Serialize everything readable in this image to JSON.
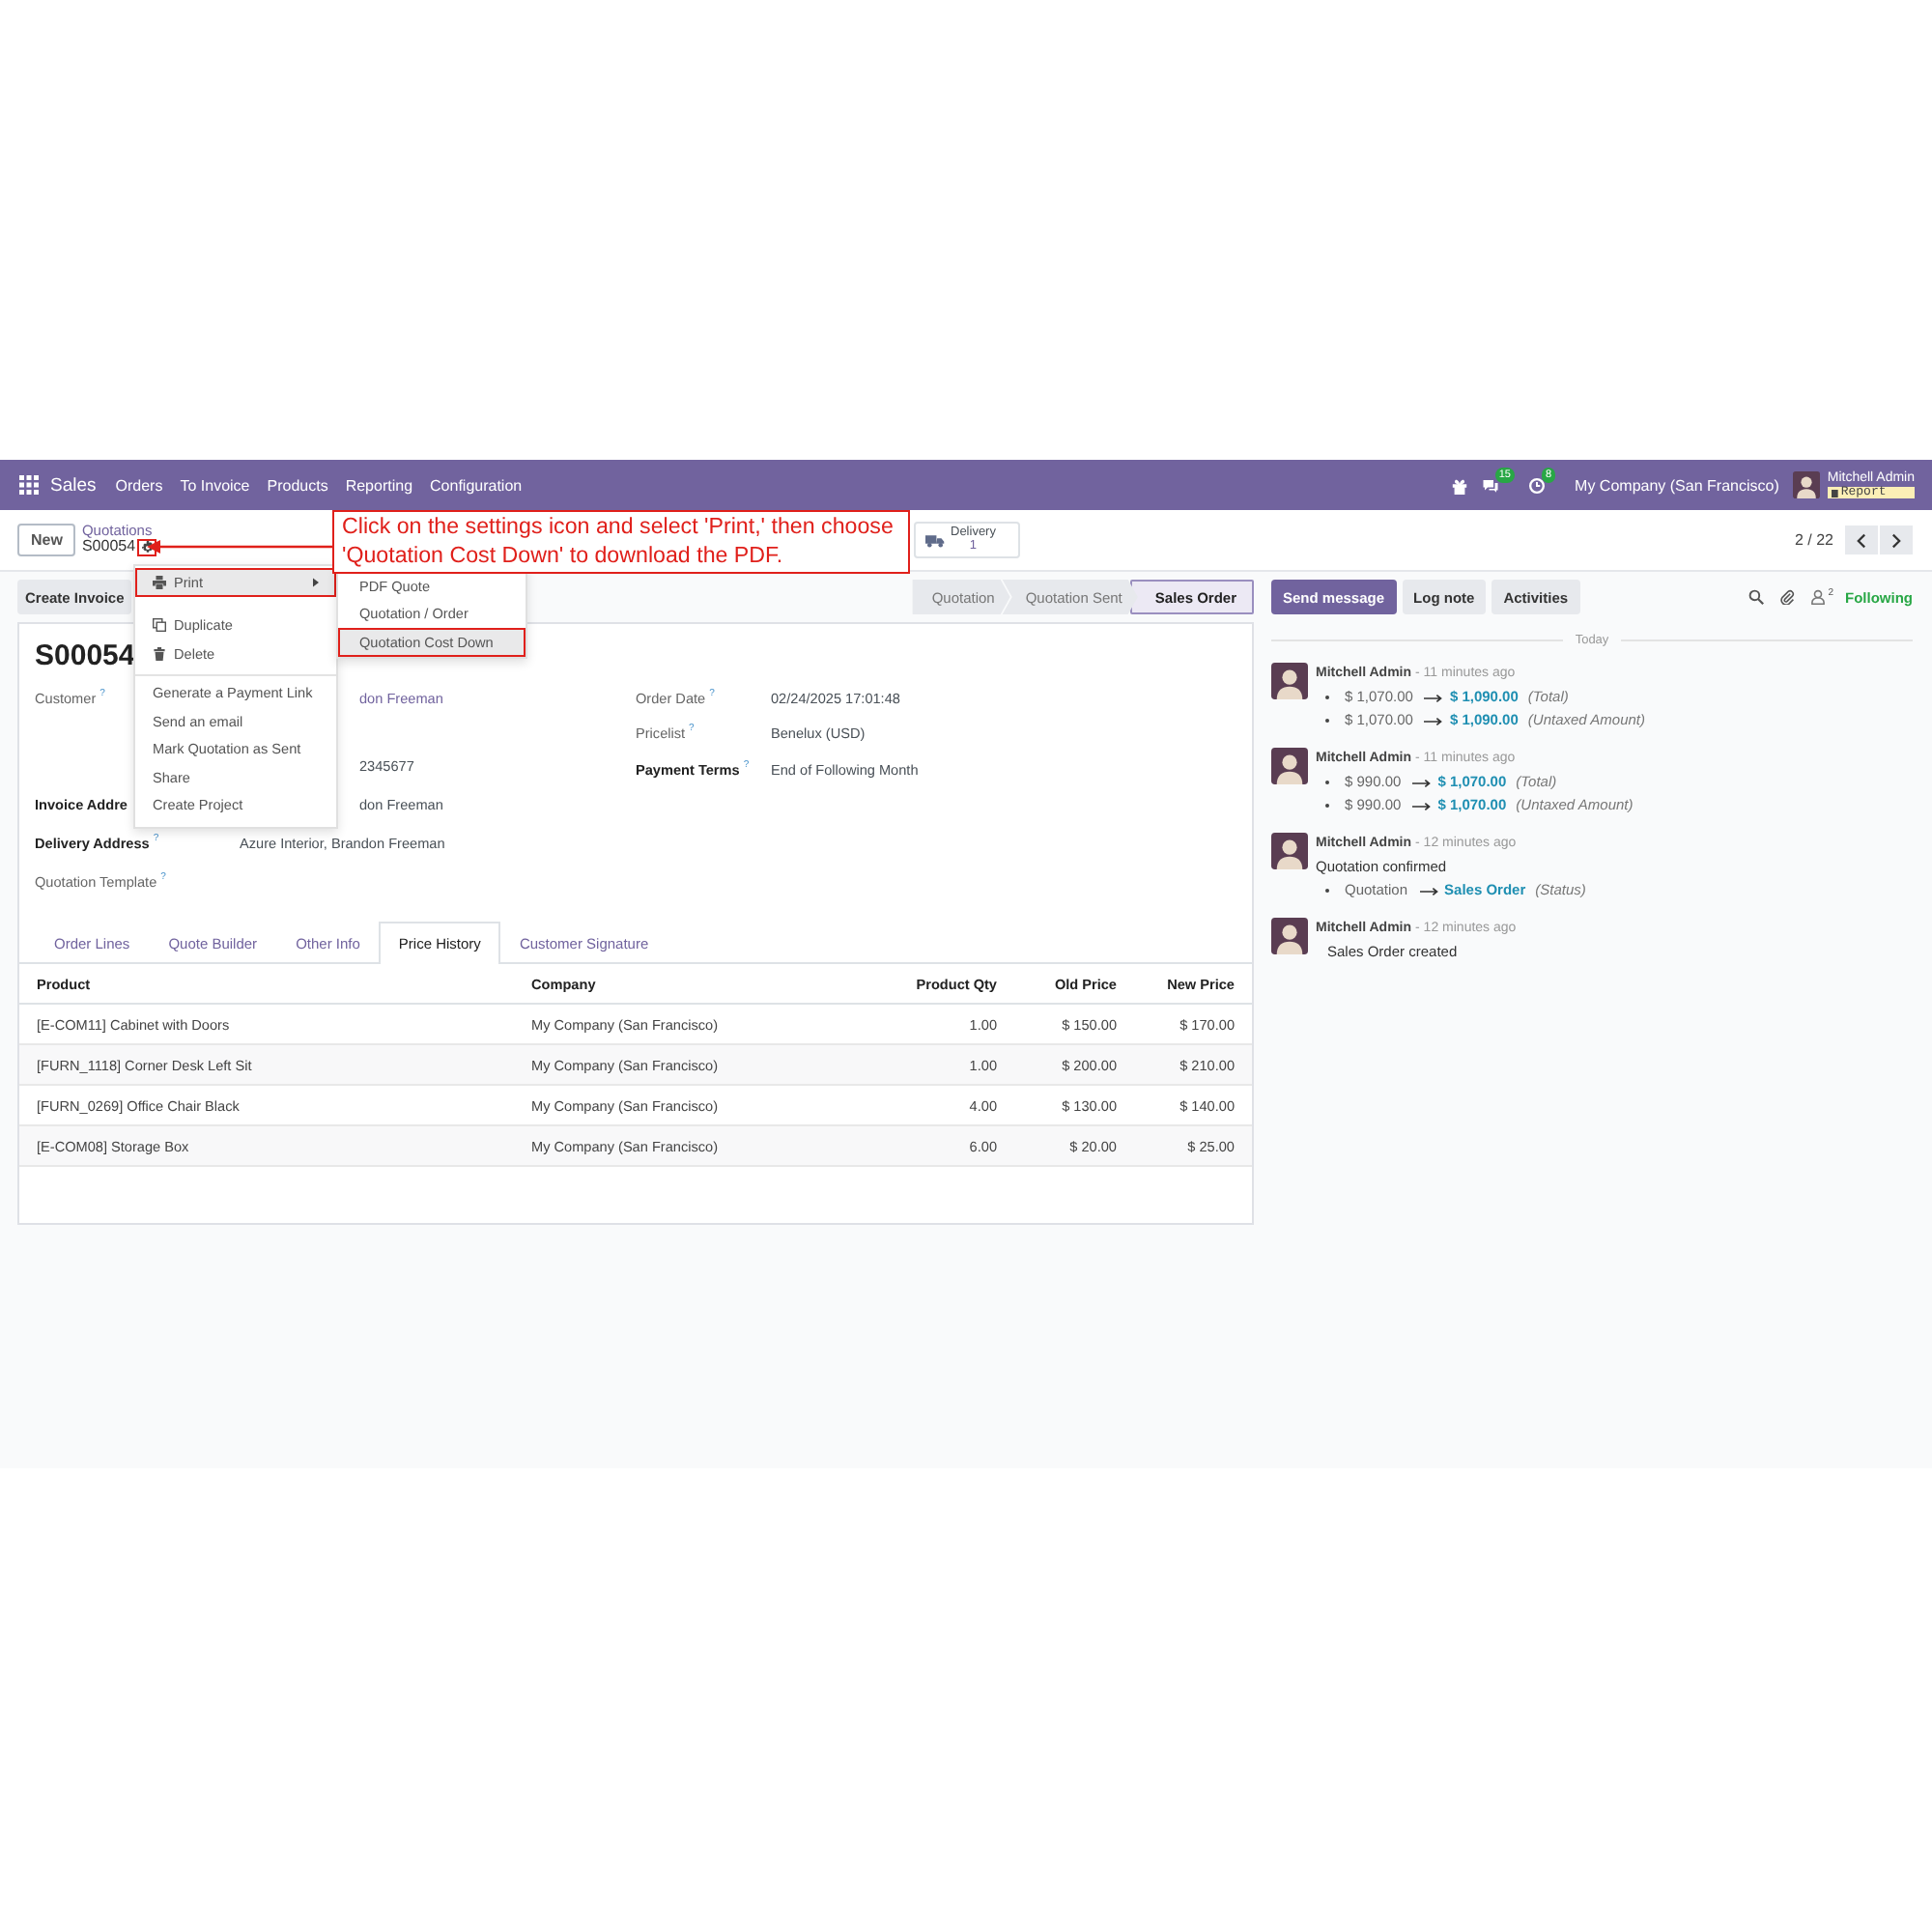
{
  "navbar": {
    "app": "Sales",
    "menu": [
      "Orders",
      "To Invoice",
      "Products",
      "Reporting",
      "Configuration"
    ],
    "messages_count": "15",
    "activities_count": "8",
    "company": "My Company (San Francisco)",
    "user": "Mitchell Admin",
    "database": "Report"
  },
  "control_panel": {
    "new_button": "New",
    "breadcrumb": "Quotations",
    "record": "S00054",
    "gear_highlighted": true,
    "smart_button": {
      "label": "Delivery",
      "count": "1"
    },
    "pager": "2 / 22"
  },
  "annotation": {
    "text": "Click on the settings icon and select 'Print,' then choose 'Quotation Cost Down' to download the PDF."
  },
  "action_menu": [
    [
      {
        "label": "Print",
        "kind": "submenu",
        "highlighted": true
      }
    ],
    [
      {
        "label": "Duplicate",
        "kind": "copy",
        "highlighted": false
      },
      {
        "label": "Delete",
        "kind": "trash",
        "highlighted": false
      }
    ],
    [
      {
        "label": "Generate a Payment Link",
        "kind": "plain",
        "highlighted": false
      },
      {
        "label": "Send an email",
        "kind": "plain",
        "highlighted": false
      },
      {
        "label": "Mark Quotation as Sent",
        "kind": "plain",
        "highlighted": false
      },
      {
        "label": "Share",
        "kind": "plain",
        "highlighted": false
      },
      {
        "label": "Create Project",
        "kind": "plain",
        "highlighted": false
      }
    ]
  ],
  "print_submenu": [
    {
      "label": "PDF Quote",
      "highlighted": false
    },
    {
      "label": "Quotation / Order",
      "highlighted": false
    },
    {
      "label": "Quotation Cost Down",
      "highlighted": true
    }
  ],
  "action_buttons": [
    "Create Invoice"
  ],
  "status_bar": [
    {
      "label": "Quotation",
      "selected": false
    },
    {
      "label": "Quotation Sent",
      "selected": false
    },
    {
      "label": "Sales Order",
      "selected": true
    }
  ],
  "form": {
    "title": "S00054",
    "left_fields": [
      {
        "label": "Customer",
        "help": "?",
        "required": false,
        "kind": "link",
        "cut": true,
        "value": "don Freeman",
        "detail": "2345677"
      },
      {
        "label": "Invoice Addre",
        "required": true,
        "kind": "text",
        "cut": true,
        "value": "don Freeman"
      },
      {
        "label": "Delivery Address",
        "help": "?",
        "required": true,
        "kind": "text",
        "value": "Azure Interior, Brandon Freeman"
      },
      {
        "label": "Quotation Template",
        "help": "?",
        "required": false,
        "kind": "empty"
      }
    ],
    "right_fields": [
      {
        "label": "Order Date",
        "help": "?",
        "required": false,
        "kind": "text",
        "value": "02/24/2025 17:01:48"
      },
      {
        "label": "Pricelist",
        "help": "?",
        "required": false,
        "kind": "text",
        "value": "Benelux (USD)"
      },
      {
        "label": "Payment Terms",
        "help": "?",
        "required": true,
        "kind": "text",
        "value": "End of Following Month"
      }
    ]
  },
  "tabs": [
    {
      "label": "Order Lines",
      "selected": false
    },
    {
      "label": "Quote Builder",
      "selected": false
    },
    {
      "label": "Other Info",
      "selected": false
    },
    {
      "label": "Price History",
      "selected": true
    },
    {
      "label": "Customer Signature",
      "selected": false
    }
  ],
  "table": {
    "columns": [
      {
        "label": "Product",
        "kind": "text"
      },
      {
        "label": "Company",
        "kind": "text"
      },
      {
        "label": "Product Qty",
        "kind": "number"
      },
      {
        "label": "Old Price",
        "kind": "number"
      },
      {
        "label": "New Price",
        "kind": "number"
      }
    ],
    "rows": [
      [
        "[E-COM11] Cabinet with Doors",
        "My Company (San Francisco)",
        "1.00",
        "$ 150.00",
        "$ 170.00"
      ],
      [
        "[FURN_1118] Corner Desk Left Sit",
        "My Company (San Francisco)",
        "1.00",
        "$ 200.00",
        "$ 210.00"
      ],
      [
        "[FURN_0269] Office Chair Black",
        "My Company (San Francisco)",
        "4.00",
        "$ 130.00",
        "$ 140.00"
      ],
      [
        "[E-COM08] Storage Box",
        "My Company (San Francisco)",
        "6.00",
        "$ 20.00",
        "$ 25.00"
      ]
    ]
  },
  "chatter": {
    "buttons": [
      {
        "label": "Send message",
        "primary": true
      },
      {
        "label": "Log note",
        "primary": false
      },
      {
        "label": "Activities",
        "primary": false
      }
    ],
    "followers_count": "2",
    "following": "Following",
    "date_separator": "Today",
    "messages": [
      {
        "author": "Mitchell Admin",
        "time": "- 11 minutes ago",
        "changes": [
          {
            "old": "$ 1,070.00",
            "new": "$ 1,090.00",
            "field": "(Total)"
          },
          {
            "old": "$ 1,070.00",
            "new": "$ 1,090.00",
            "field": "(Untaxed Amount)"
          }
        ]
      },
      {
        "author": "Mitchell Admin",
        "time": "- 11 minutes ago",
        "changes": [
          {
            "old": "$ 990.00",
            "new": "$ 1,070.00",
            "field": "(Total)"
          },
          {
            "old": "$ 990.00",
            "new": "$ 1,070.00",
            "field": "(Untaxed Amount)"
          }
        ]
      },
      {
        "author": "Mitchell Admin",
        "time": "- 12 minutes ago",
        "body": "Quotation confirmed",
        "changes": [
          {
            "old": "Quotation",
            "new": "Sales Order",
            "field": "(Status)"
          }
        ]
      },
      {
        "author": "Mitchell Admin",
        "time": "- 12 minutes ago",
        "body": "Sales Order created"
      }
    ]
  }
}
